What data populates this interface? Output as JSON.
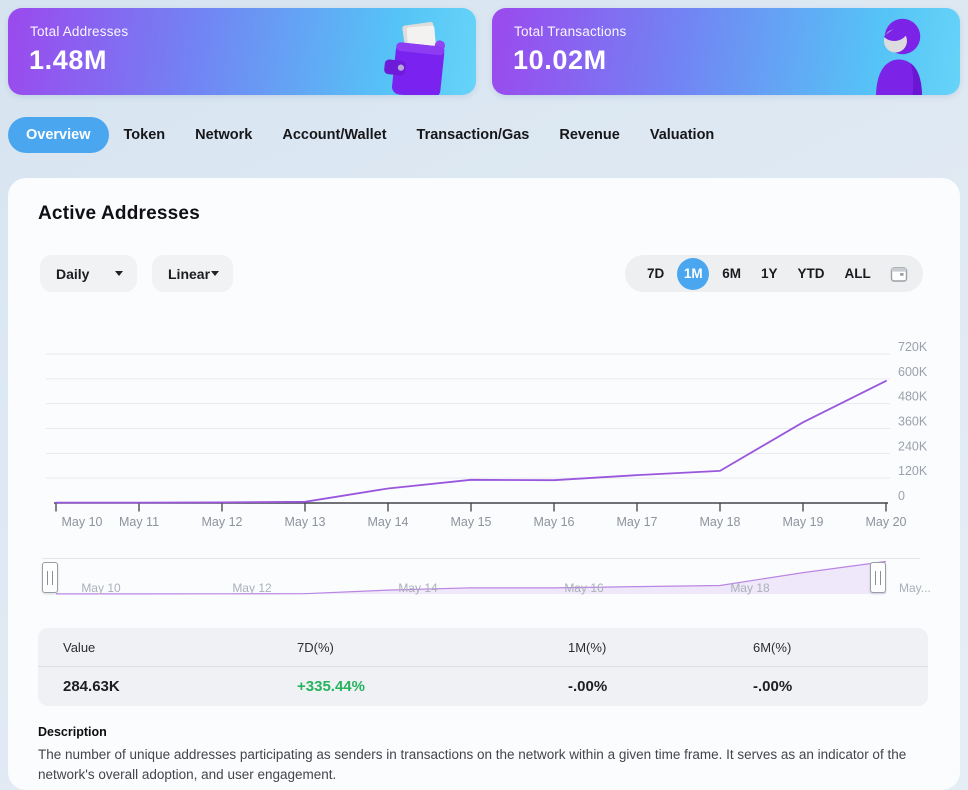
{
  "stat_cards": [
    {
      "label": "Total Addresses",
      "value": "1.48M",
      "icon": "wallet-3d-icon"
    },
    {
      "label": "Total Transactions",
      "value": "10.02M",
      "icon": "person-3d-icon"
    }
  ],
  "tabs": {
    "items": [
      {
        "label": "Overview",
        "active": true
      },
      {
        "label": "Token",
        "active": false
      },
      {
        "label": "Network",
        "active": false
      },
      {
        "label": "Account/Wallet",
        "active": false
      },
      {
        "label": "Transaction/Gas",
        "active": false
      },
      {
        "label": "Revenue",
        "active": false
      },
      {
        "label": "Valuation",
        "active": false
      }
    ]
  },
  "panel": {
    "title": "Active Addresses",
    "interval_select": {
      "value": "Daily"
    },
    "scale_select": {
      "value": "Linear"
    },
    "ranges": {
      "items": [
        "7D",
        "1M",
        "6M",
        "1Y",
        "YTD",
        "ALL"
      ],
      "active": "1M"
    }
  },
  "chart_data": {
    "type": "line",
    "title": "Active Addresses",
    "x": [
      "May 10",
      "May 11",
      "May 12",
      "May 13",
      "May 14",
      "May 15",
      "May 16",
      "May 17",
      "May 18",
      "May 19",
      "May 20"
    ],
    "series": [
      {
        "name": "Active Addresses",
        "values": [
          2000,
          2000,
          3000,
          6000,
          70000,
          112000,
          110000,
          135000,
          155000,
          390000,
          590000
        ]
      }
    ],
    "ylim": [
      0,
      720000
    ],
    "yticks": [
      {
        "label": "720K",
        "value": 720000
      },
      {
        "label": "600K",
        "value": 600000
      },
      {
        "label": "480K",
        "value": 480000
      },
      {
        "label": "360K",
        "value": 360000
      },
      {
        "label": "240K",
        "value": 240000
      },
      {
        "label": "120K",
        "value": 120000
      },
      {
        "label": "0",
        "value": 0
      }
    ],
    "grid": "horizontal",
    "legend": "none",
    "line_color": "#9a57dd",
    "brush": {
      "labels": [
        "May 10",
        "May 12",
        "May 14",
        "May 16",
        "May 18",
        "May..."
      ]
    }
  },
  "stats_table": {
    "headers": [
      "Value",
      "7D(%)",
      "1M(%)",
      "6M(%)"
    ],
    "rows": [
      [
        "284.63K",
        "+335.44%",
        "-.00%",
        "-.00%"
      ]
    ]
  },
  "description": {
    "heading": "Description",
    "text": "The number of unique addresses participating as senders in transactions on the network within a given time frame. It serves as an indicator of the network's overall adoption, and user engagement."
  },
  "colors": {
    "accent_blue": "#4aa7ef",
    "card_gradient_from": "#9b49ee",
    "card_gradient_to": "#55c4f6",
    "line_purple": "#9a57dd",
    "positive_green": "#26b35e"
  }
}
